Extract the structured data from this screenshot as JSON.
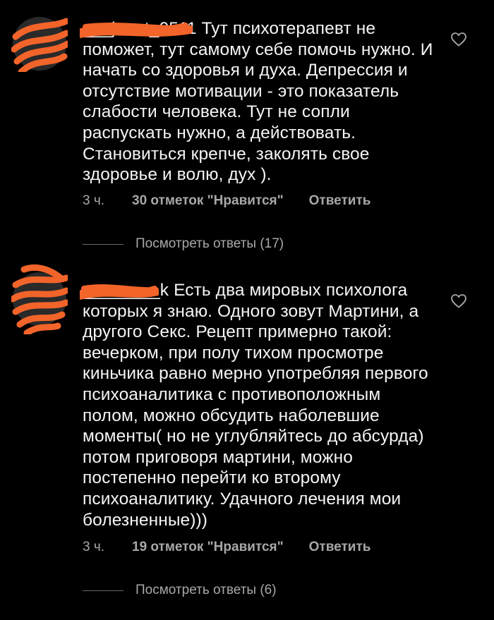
{
  "colors": {
    "background": "#000000",
    "text": "#f5f5f5",
    "muted": "#a8a8a8",
    "redaction": "#f2642a"
  },
  "comments": [
    {
      "username": "___janet_0511",
      "text": "Тут психотерапевт не поможет, тут самому себе помочь нужно. И начать со здоровья и духа. Депрессия и отсутствие мотивации - это показатель слабости человека. Тут не сопли распускать нужно, а действовать. Становиться крепче, заколять свое здоровье и волю, дух ).",
      "time": "3 ч.",
      "likes": "30 отметок \"Нравится\"",
      "reply": "Ответить",
      "view_replies": "Посмотреть ответы (17)",
      "like_icon": "heart-outline-icon"
    },
    {
      "username": "________k",
      "text": "Есть два мировых психолога которых я знаю. Одного зовут Мартини, а другого Секс. Рецепт примерно такой: вечерком, при полу тихом просмотре киньчика равно мерно употребляя первого психоаналитика с противоположным полом, можно обсудить наболевшие моменты( но не углубляйтесь до абсурда) потом приговоря мартини, можно постепенно перейти ко второму психоаналитику. Удачного лечения мои болезненные)))",
      "time": "3 ч.",
      "likes": "19 отметок \"Нравится\"",
      "reply": "Ответить",
      "view_replies": "Посмотреть ответы (6)",
      "like_icon": "heart-outline-icon"
    }
  ]
}
